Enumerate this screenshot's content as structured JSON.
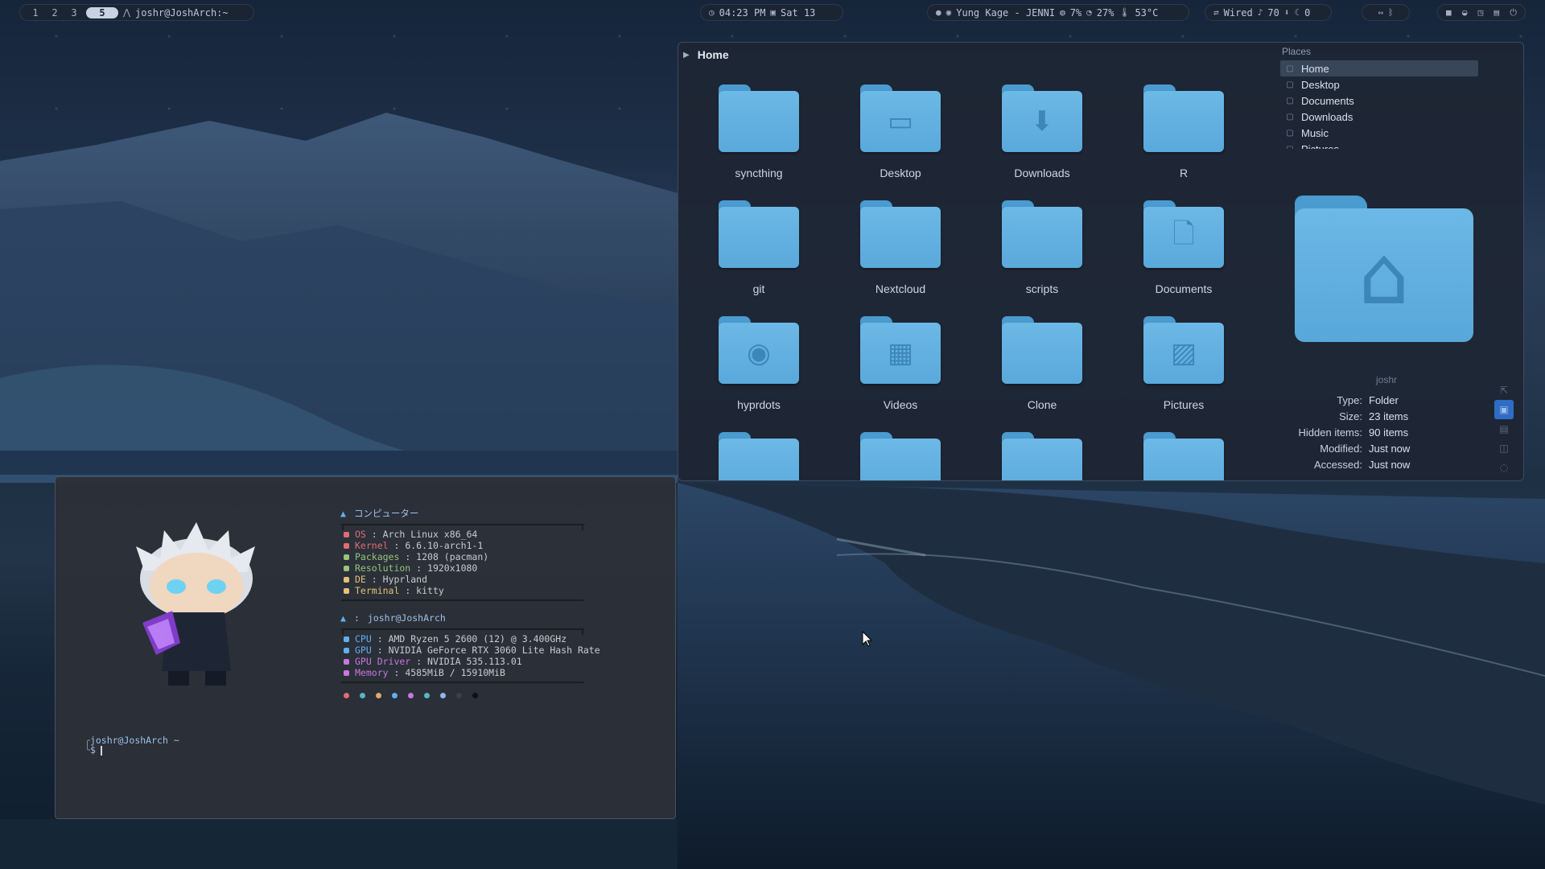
{
  "topbar": {
    "workspaces": [
      "1",
      "2",
      "3",
      "5"
    ],
    "active_workspace": "5",
    "window_title": "joshr@JoshArch:~",
    "clock": "04:23 PM",
    "date": "Sat 13",
    "media": "Yung Kage - JENNI",
    "cpu": "7%",
    "ram": "27%",
    "temp": "53°C",
    "network": "Wired",
    "volume": "70",
    "mic": "0"
  },
  "file_manager": {
    "location": "Home",
    "folders": [
      {
        "name": "syncthing",
        "icon": "folder-plain"
      },
      {
        "name": "Desktop",
        "icon": "desktop"
      },
      {
        "name": "Downloads",
        "icon": "download"
      },
      {
        "name": "R",
        "icon": "folder-plain"
      },
      {
        "name": "git",
        "icon": "folder-plain"
      },
      {
        "name": "Nextcloud",
        "icon": "folder-plain"
      },
      {
        "name": "scripts",
        "icon": "folder-plain"
      },
      {
        "name": "Documents",
        "icon": "document"
      },
      {
        "name": "hyprdots",
        "icon": "github"
      },
      {
        "name": "Videos",
        "icon": "film"
      },
      {
        "name": "Clone",
        "icon": "folder-plain"
      },
      {
        "name": "Pictures",
        "icon": "image"
      },
      {
        "name": "",
        "icon": "folder-plain"
      },
      {
        "name": "",
        "icon": "folder-plain"
      },
      {
        "name": "",
        "icon": "folder-plain"
      },
      {
        "name": "",
        "icon": "folder-plain"
      }
    ],
    "places_title": "Places",
    "places": [
      {
        "label": "Home",
        "icon": "home-icon",
        "selected": true
      },
      {
        "label": "Desktop",
        "icon": "desktop-icon"
      },
      {
        "label": "Documents",
        "icon": "document-icon"
      },
      {
        "label": "Downloads",
        "icon": "download-icon"
      },
      {
        "label": "Music",
        "icon": "music-icon"
      },
      {
        "label": "Pictures",
        "icon": "pictures-icon"
      }
    ],
    "info": {
      "name": "joshr",
      "rows": [
        {
          "key": "Type:",
          "value": "Folder"
        },
        {
          "key": "Size:",
          "value": "23 items"
        },
        {
          "key": "Hidden items:",
          "value": "90 items"
        },
        {
          "key": "Modified:",
          "value": "Just now"
        },
        {
          "key": "Accessed:",
          "value": "Just now"
        }
      ]
    }
  },
  "terminal": {
    "header1": "コンピューター",
    "system": [
      {
        "key": "OS",
        "value": "Arch Linux x86_64",
        "color": "#e06c75"
      },
      {
        "key": "Kernel",
        "value": "6.6.10-arch1-1",
        "color": "#e06c75"
      },
      {
        "key": "Packages",
        "value": "1208 (pacman)",
        "color": "#98c379"
      },
      {
        "key": "Resolution",
        "value": "1920x1080",
        "color": "#98c379"
      },
      {
        "key": "DE",
        "value": "Hyprland",
        "color": "#e5c07b"
      },
      {
        "key": "Terminal",
        "value": "kitty",
        "color": "#e5c07b"
      }
    ],
    "header2": "joshr@JoshArch",
    "hardware": [
      {
        "key": "CPU",
        "value": "AMD Ryzen 5 2600 (12) @ 3.400GHz",
        "color": "#61afef"
      },
      {
        "key": "GPU",
        "value": "NVIDIA GeForce RTX 3060 Lite Hash Rate",
        "color": "#61afef"
      },
      {
        "key": "GPU Driver",
        "value": "NVIDIA 535.113.01",
        "color": "#c678dd"
      },
      {
        "key": "Memory",
        "value": "4585MiB / 15910MiB",
        "color": "#c678dd"
      }
    ],
    "palette": [
      "#e06c75",
      "#56b6c2",
      "#e5a66b",
      "#61afef",
      "#c678dd",
      "#56b6c2",
      "#8fb6f0",
      "#3a3f4b",
      "#0d0f12"
    ],
    "prompt_user": "joshr@JoshArch",
    "prompt_path": "~",
    "prompt_symbol": "$"
  }
}
